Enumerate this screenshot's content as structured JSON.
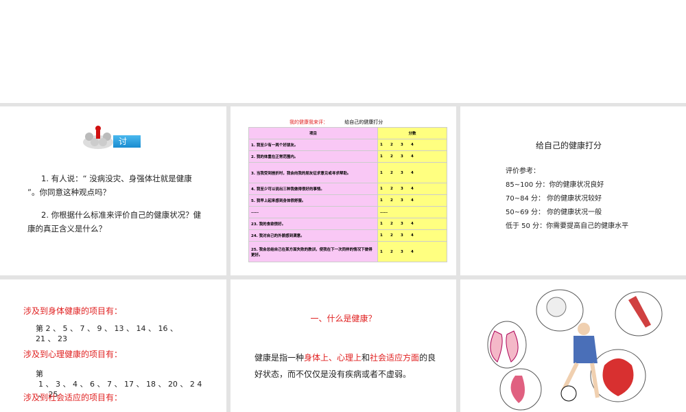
{
  "slide1": {
    "badge": "讨",
    "q1": "1. 有人说：“ 没病没灾、身强体壮就是健康 ”。你同意这种观点吗？",
    "q2": "2. 你根据什么标准来评价自己的健康状况？健康的真正含义是什么？"
  },
  "slide2": {
    "title_red": "我的健康我来评：",
    "title": "给自己的健康打分",
    "col_item": "项目",
    "col_score": "分数",
    "rows": [
      {
        "item": "1. 我至少有一两个好朋友。",
        "scores": [
          "1",
          "2",
          "3",
          "4"
        ]
      },
      {
        "item": "2. 我的体重在正常范围内。",
        "scores": [
          "1",
          "2",
          "3",
          "4"
        ]
      },
      {
        "item": "3. 当我受到挫折时，我会向我的朋友征求意见或寻求帮助。",
        "scores": [
          "1",
          "2",
          "3",
          "4"
        ]
      },
      {
        "item": "4. 我至少可以说出三种我做得很好的事情。",
        "scores": [
          "1",
          "2",
          "3",
          "4"
        ]
      },
      {
        "item": "5. 我早上起来感到身体很舒服。",
        "scores": [
          "1",
          "2",
          "3",
          "4"
        ]
      },
      {
        "item": "……",
        "scores": [
          "……"
        ]
      },
      {
        "item": "23. 我的食欲很好。",
        "scores": [
          "1",
          "2",
          "3",
          "4"
        ]
      },
      {
        "item": "24. 我对自己的外貌感到满意。",
        "scores": [
          "1",
          "2",
          "3",
          "4"
        ]
      },
      {
        "item": "25. 我会总结自己在某方面失败的教训，使我在下一次同样的情况下做得更好。",
        "scores": [
          "1",
          "2",
          "3",
          "4"
        ]
      }
    ]
  },
  "slide3": {
    "title": "给自己的健康打分",
    "ref": "评价参考：",
    "lines": [
      "85~100 分：你的健康状况良好",
      "70~84 分：  你的健康状况较好",
      "50~69 分：  你的健康状况一般",
      "低于 50 分：你需要提高自己的健康水平"
    ]
  },
  "slide4": {
    "h1": "涉及到身体健康的项目有：",
    "n1": "第 2 、 5 、 7 、 9 、 13 、 14 、 16 、 21 、 23",
    "h2": "涉及到心理健康的项目有：",
    "n2a": "第",
    "n2b": "1 、 3 、 4 、 6 、 7 、 17 、 18 、 20 、 2 4 、 25",
    "h3": "涉及到社会适应的项目有："
  },
  "slide5": {
    "title": "一、什么是健康？",
    "p1": "健康是指一种",
    "r1": "身体上、心理上",
    "p2": "和",
    "r2": "社会适应方面",
    "p3": "的良好状态，而不仅仅是没有疾病或者不虚弱。"
  },
  "colors": {
    "red": "#e02020",
    "pink": "#f9c8f5",
    "yellow": "#ffff80",
    "badge": "#1a8cd0"
  }
}
